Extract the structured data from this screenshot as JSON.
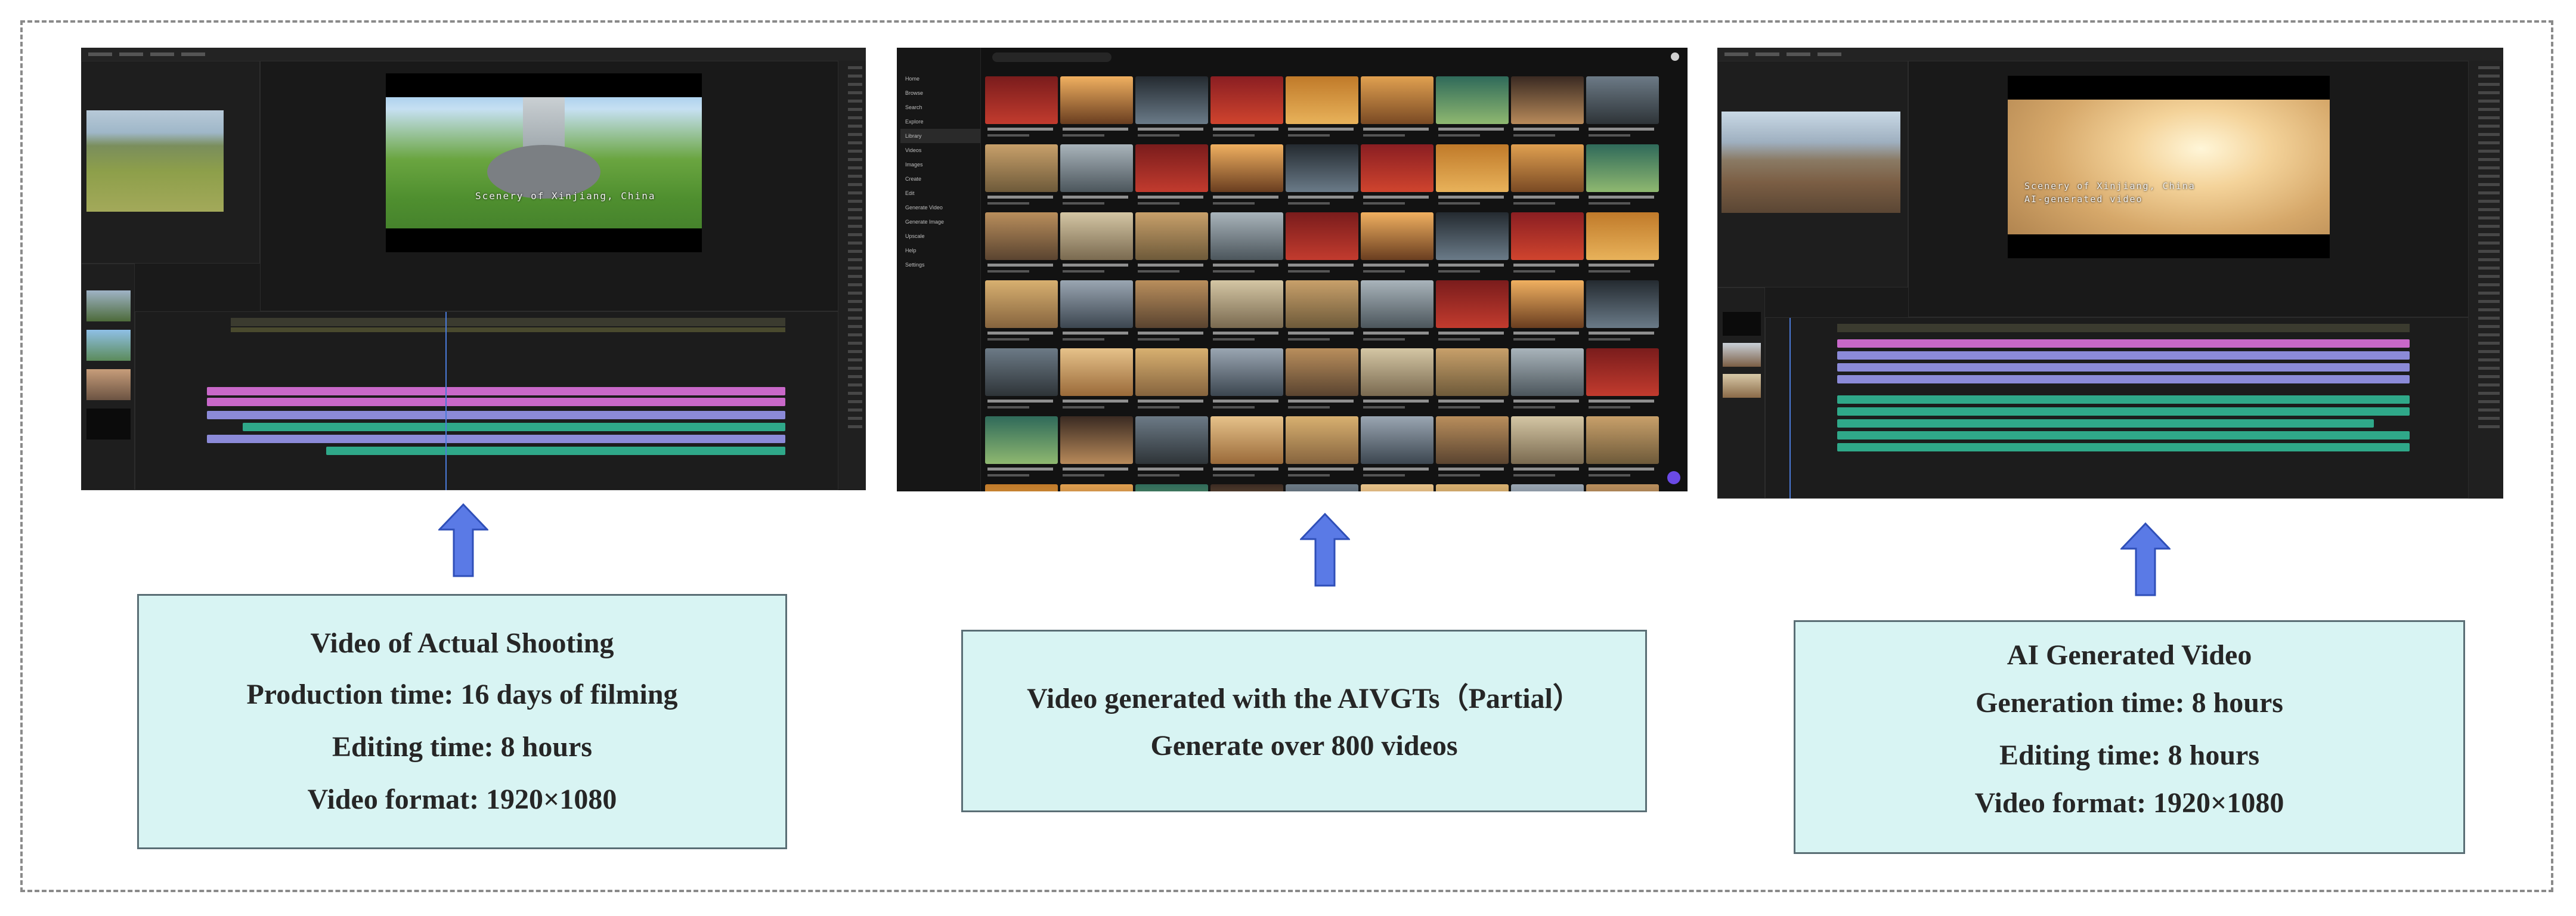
{
  "panels": [
    {
      "id": "actual",
      "screen_caption": "Scenery of Xinjiang, China",
      "box_lines": [
        "Video of Actual Shooting",
        "Production time: 16 days of filming",
        "Editing time: 8 hours",
        "Video format: 1920×1080"
      ]
    },
    {
      "id": "aivgts",
      "box_lines": [
        "Video generated with the AIVGTs（Partial）",
        "Generate over 800 videos"
      ],
      "gallery": {
        "sidebar_items": [
          "Home",
          "Browse",
          "Search",
          "Explore",
          "Library",
          "Videos",
          "Images",
          "Create",
          "Edit",
          "Generate Video",
          "Generate Image",
          "Upscale",
          "Help",
          "Settings"
        ],
        "tile_count": 63
      }
    },
    {
      "id": "ai",
      "screen_caption_line1": "Scenery of Xinjiang, China",
      "screen_caption_line2": "AI-generated video",
      "box_lines": [
        "AI Generated Video",
        "Generation time: 8 hours",
        "Editing time: 8 hours",
        "Video format: 1920×1080"
      ]
    }
  ],
  "colors": {
    "arrow_fill": "#5a7ae6",
    "arrow_stroke": "#2f4fb8",
    "box_fill": "#d8f4f3",
    "box_border": "#5a6e75",
    "dash_border": "#8a8a8a",
    "clip_pink": "#c968c9",
    "clip_teal": "#2fa889",
    "clip_lilac": "#8b8ad8"
  }
}
